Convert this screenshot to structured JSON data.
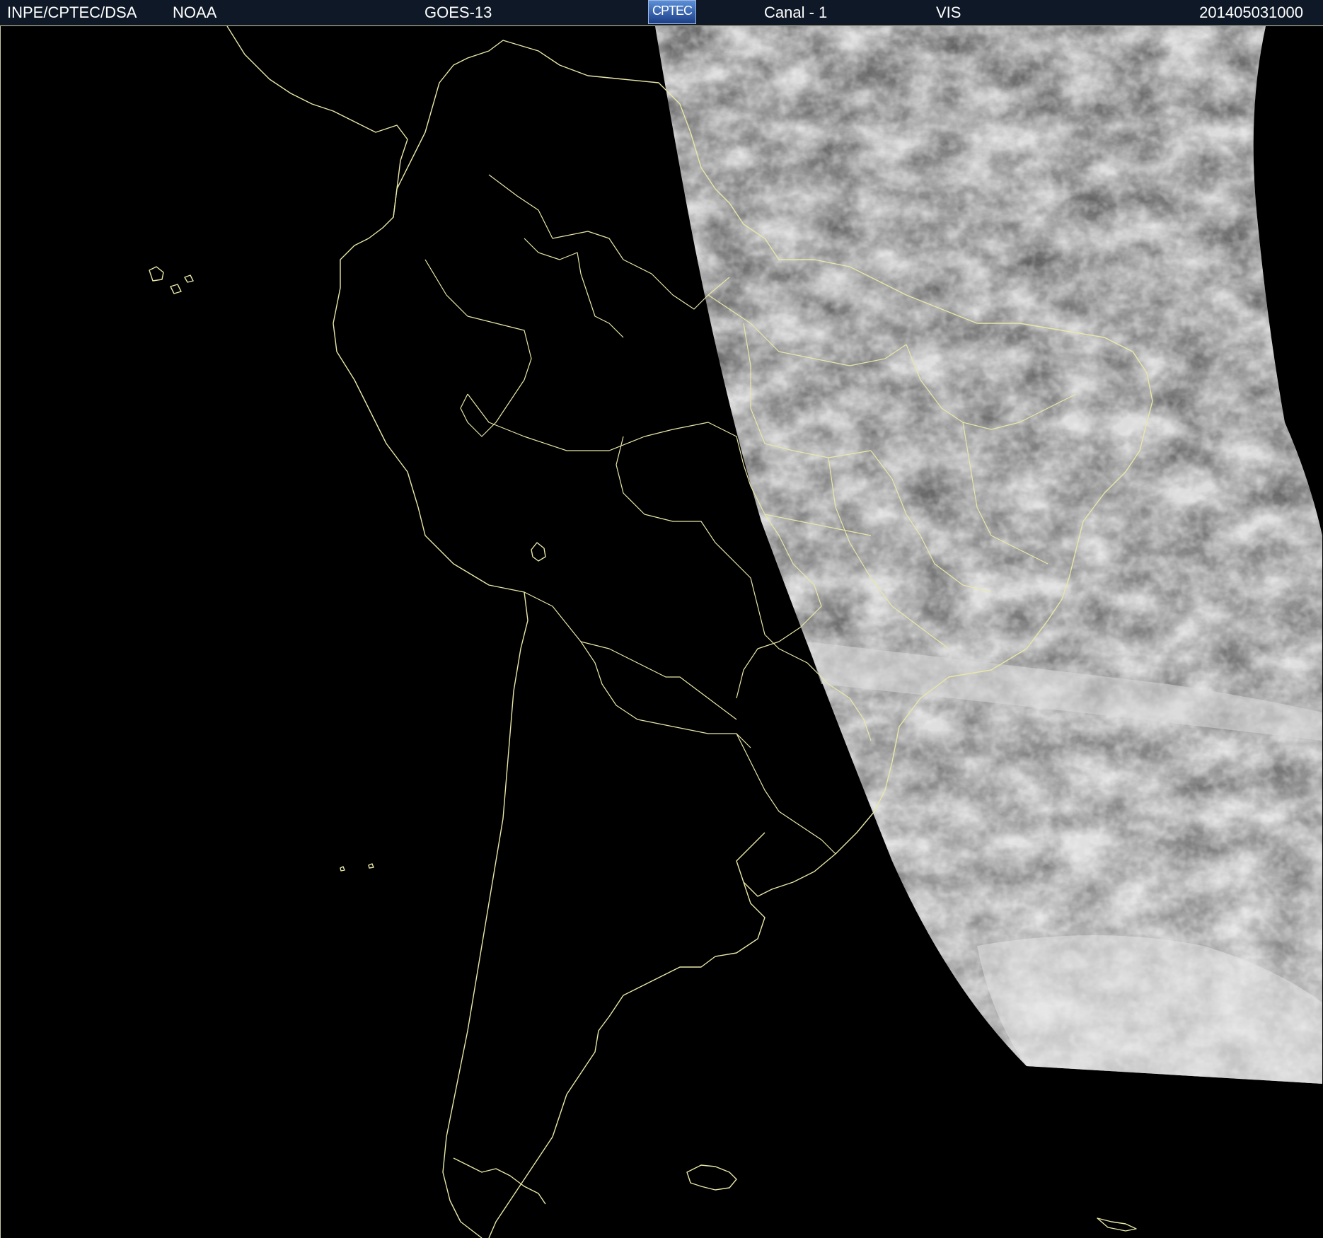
{
  "header": {
    "agency": "INPE/CPTEC/DSA",
    "partner": "NOAA",
    "satellite": "GOES-13",
    "logo_text": "CPTEC",
    "channel": "Canal - 1",
    "band": "VIS",
    "timestamp": "201405031000"
  },
  "map": {
    "background_color": "#000000",
    "overlay_line_color": "#e9e7a7",
    "imagery": "visible-cloud-cover"
  }
}
